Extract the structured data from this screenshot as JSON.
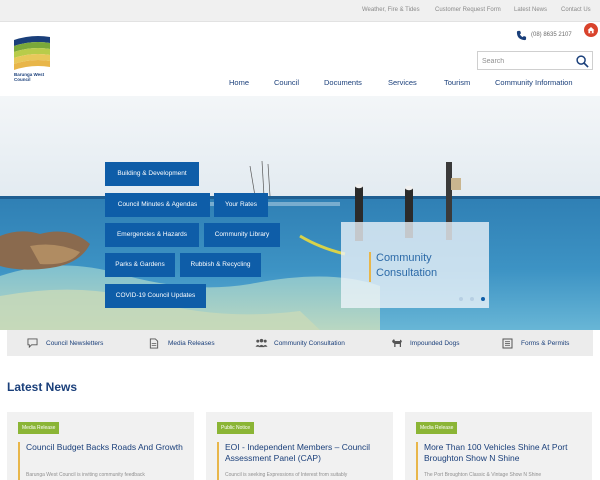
{
  "utility_links": [
    "Weather, Fire & Tides",
    "Customer Request Form",
    "Latest News",
    "Contact Us"
  ],
  "logo": {
    "text": "Barunga West Council"
  },
  "phone": "(08) 8635 2107",
  "search": {
    "placeholder": "Search"
  },
  "main_nav": [
    "Home",
    "Council",
    "Documents",
    "Services",
    "Tourism",
    "Community Information"
  ],
  "quick_links": [
    "Building & Development",
    "Council Minutes & Agendas",
    "Your Rates",
    "Emergencies & Hazards",
    "Community Library",
    "Parks & Gardens",
    "Rubbish & Recycling",
    "COVID-19 Council Updates"
  ],
  "slide": {
    "text": "Community Consultation",
    "count": 3,
    "active": 3
  },
  "feature_links": [
    {
      "label": "Council Newsletters",
      "icon": "speech-bubble-icon"
    },
    {
      "label": "Media Releases",
      "icon": "document-icon"
    },
    {
      "label": "Community Consultation",
      "icon": "people-icon"
    },
    {
      "label": "Impounded Dogs",
      "icon": "dog-icon"
    },
    {
      "label": "Forms & Permits",
      "icon": "forms-icon"
    }
  ],
  "latest_news": {
    "title": "Latest News",
    "items": [
      {
        "tag": "Media Release",
        "title": "Council Budget Backs Roads And Growth",
        "excerpt": "Barunga West Council is inviting community feedback"
      },
      {
        "tag": "Public Notice",
        "title": "EOI - Independent Members – Council Assessment Panel (CAP)",
        "excerpt": "Council is seeking Expressions of Interest from suitably"
      },
      {
        "tag": "Media Release",
        "title": "More Than 100 Vehicles Shine At Port Broughton Show N Shine",
        "excerpt": "The Port Broughton Classic & Vintage Show N Shine"
      }
    ]
  },
  "colors": {
    "primary": "#1a3f7a",
    "button": "#0e5da8",
    "accent": "#e8b64a",
    "tag": "#8bb536",
    "alert": "#d9432c"
  }
}
